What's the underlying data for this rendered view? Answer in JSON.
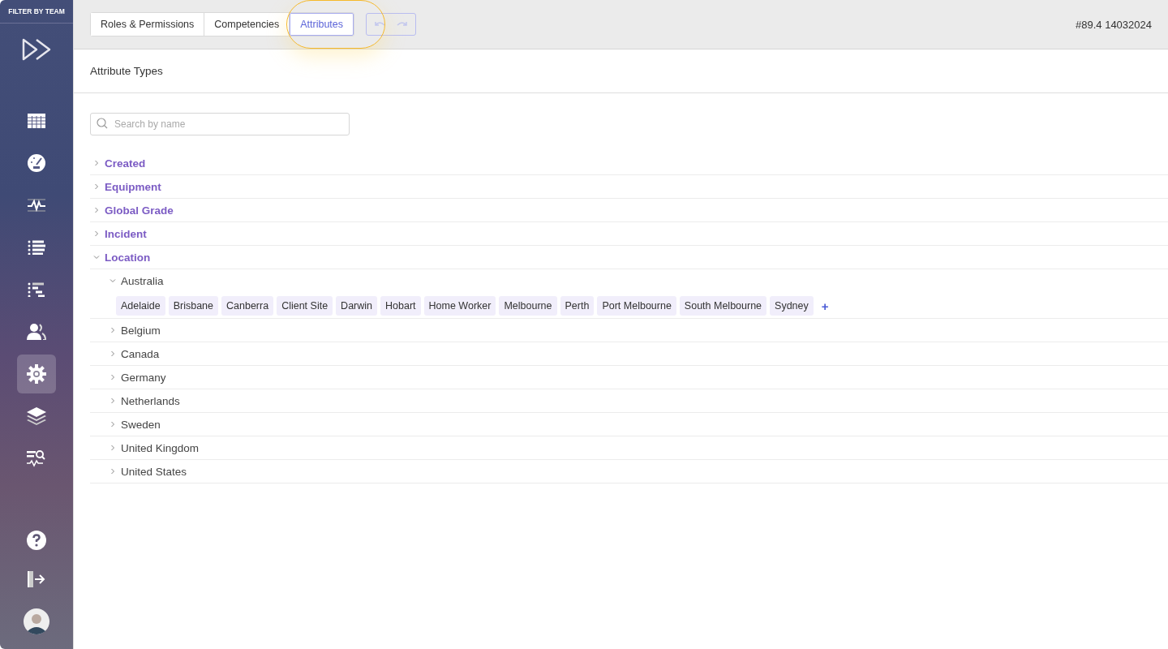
{
  "sidebar": {
    "header": "FILTER BY TEAM",
    "items": [
      {
        "kind": "grid",
        "selected": false
      },
      {
        "kind": "gauge",
        "selected": false
      },
      {
        "kind": "pulse",
        "selected": false
      },
      {
        "kind": "list",
        "selected": false
      },
      {
        "kind": "tree",
        "selected": false
      },
      {
        "kind": "users",
        "selected": false
      },
      {
        "kind": "gear",
        "selected": true
      },
      {
        "kind": "layers",
        "selected": false
      },
      {
        "kind": "monitor",
        "selected": false
      }
    ]
  },
  "tabs": [
    {
      "label": "Roles & Permissions",
      "selected": false
    },
    {
      "label": "Competencies",
      "selected": false
    },
    {
      "label": "Attributes",
      "selected": true
    }
  ],
  "version": "#89.4 14032024",
  "panel": {
    "title": "Attribute Types",
    "search": {
      "placeholder": "Search by name"
    },
    "tree": [
      {
        "label": "Created",
        "expanded": false
      },
      {
        "label": "Equipment",
        "expanded": false
      },
      {
        "label": "Global Grade",
        "expanded": false
      },
      {
        "label": "Incident",
        "expanded": false
      },
      {
        "label": "Location",
        "expanded": true,
        "children": [
          {
            "label": "Australia",
            "expanded": true,
            "tags": [
              "Adelaide",
              "Brisbane",
              "Canberra",
              "Client Site",
              "Darwin",
              "Hobart",
              "Home Worker",
              "Melbourne",
              "Perth",
              "Port Melbourne",
              "South Melbourne",
              "Sydney"
            ],
            "add": "+"
          },
          {
            "label": "Belgium",
            "expanded": false
          },
          {
            "label": "Canada",
            "expanded": false
          },
          {
            "label": "Germany",
            "expanded": false
          },
          {
            "label": "Netherlands",
            "expanded": false
          },
          {
            "label": "Sweden",
            "expanded": false
          },
          {
            "label": "United Kingdom",
            "expanded": false
          },
          {
            "label": "United States",
            "expanded": false
          }
        ]
      }
    ]
  }
}
